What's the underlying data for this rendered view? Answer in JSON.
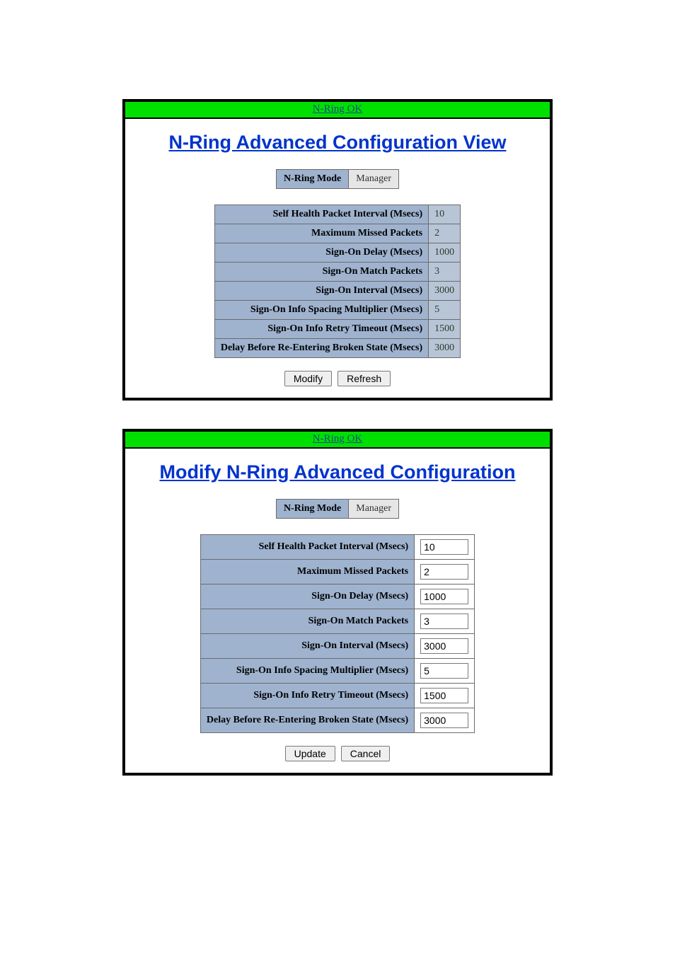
{
  "status_text": "N-Ring OK",
  "mode_label": "N-Ring Mode",
  "mode_value": "Manager",
  "settings": [
    {
      "label": "Self Health Packet Interval (Msecs)",
      "value": "10"
    },
    {
      "label": "Maximum Missed Packets",
      "value": "2"
    },
    {
      "label": "Sign-On Delay (Msecs)",
      "value": "1000"
    },
    {
      "label": "Sign-On Match Packets",
      "value": "3"
    },
    {
      "label": "Sign-On Interval (Msecs)",
      "value": "3000"
    },
    {
      "label": "Sign-On Info Spacing Multiplier (Msecs)",
      "value": "5"
    },
    {
      "label": "Sign-On Info Retry Timeout (Msecs)",
      "value": "1500"
    },
    {
      "label": "Delay Before Re-Entering Broken State (Msecs)",
      "value": "3000"
    }
  ],
  "view_panel": {
    "title": "N-Ring Advanced Configuration View",
    "buttons": {
      "modify": "Modify",
      "refresh": "Refresh"
    }
  },
  "modify_panel": {
    "title": "Modify N-Ring Advanced Configuration",
    "buttons": {
      "update": "Update",
      "cancel": "Cancel"
    }
  }
}
